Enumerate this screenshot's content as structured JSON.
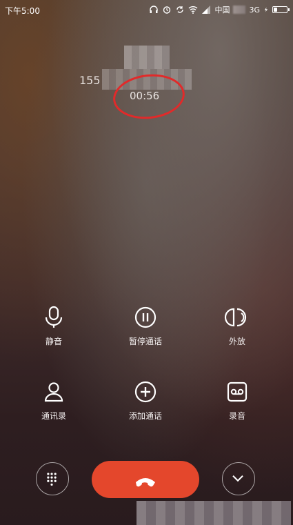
{
  "status_bar": {
    "time": "下午5:00",
    "carrier": "中国",
    "network": "3G",
    "battery_level": 0.3
  },
  "call": {
    "number_prefix": "155",
    "duration": "00:56"
  },
  "controls": [
    {
      "label": "静音",
      "icon": "microphone-icon"
    },
    {
      "label": "暂停通话",
      "icon": "pause-icon"
    },
    {
      "label": "外放",
      "icon": "speaker-icon"
    },
    {
      "label": "通讯录",
      "icon": "contacts-icon"
    },
    {
      "label": "添加通话",
      "icon": "add-call-icon"
    },
    {
      "label": "录音",
      "icon": "record-icon"
    }
  ],
  "bottom": {
    "dialpad_icon": "dialpad-icon",
    "end_call_icon": "end-call-icon",
    "collapse_icon": "chevron-down-icon",
    "end_call_color": "#e4472c"
  },
  "annotation_color": "#e12a2a"
}
